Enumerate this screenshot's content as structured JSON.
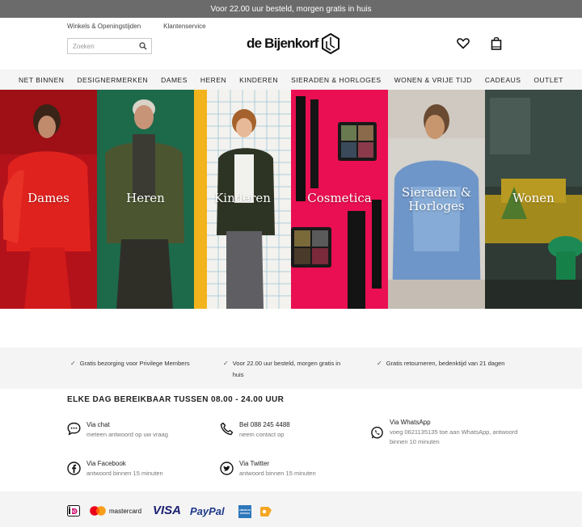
{
  "topbar": {
    "text": "Voor 22.00 uur besteld, morgen gratis in huis"
  },
  "header": {
    "links": [
      "Winkels & Openingstijden",
      "Klantenservice"
    ],
    "search_placeholder": "Zoeken",
    "logo_text": "de Bijenkorf"
  },
  "nav": [
    "NET BINNEN",
    "DESIGNERMERKEN",
    "DAMES",
    "HEREN",
    "KINDEREN",
    "SIERADEN & HORLOGES",
    "WONEN & VRIJE TIJD",
    "CADEAUS",
    "OUTLET"
  ],
  "tiles": [
    {
      "label": "Dames",
      "color": "#c8161d"
    },
    {
      "label": "Heren",
      "color": "#1e6b4c"
    },
    {
      "label": "Kinderen",
      "color": "#f0efe9"
    },
    {
      "label": "Cosmetica",
      "color": "#e8104f"
    },
    {
      "label": "Sieraden &",
      "label2": "Horloges",
      "color": "#7ea3cf"
    },
    {
      "label": "Wonen",
      "color": "#3e4a3a"
    }
  ],
  "usps": [
    "Gratis bezorging voor Privilege Members",
    "Voor 22.00 uur besteld, morgen gratis in",
    "huis",
    "Gratis retourneren, bedenktijd van 21 dagen"
  ],
  "contact": {
    "title": "ELKE DAG BEREIKBAAR TUSSEN 08.00 - 24.00 UUR",
    "items": [
      {
        "title": "Via chat",
        "desc": "meteen antwoord op uw vraag",
        "icon": "chat-icon"
      },
      {
        "title": "Bel 088 245 4488",
        "desc": "neem contact op",
        "icon": "phone-icon"
      },
      {
        "title": "Via WhatsApp",
        "desc": "voeg 0621135135 toe aan WhatsApp, antwoord",
        "desc2": "binnen 10 minuten",
        "icon": "whatsapp-icon"
      },
      {
        "title": "Via Facebook",
        "desc": "antwoord binnen 15 minuten",
        "icon": "facebook-icon"
      },
      {
        "title": "Via Twitter",
        "desc": "antwoord binnen 15 minuten",
        "icon": "twitter-icon"
      }
    ]
  },
  "payments": {
    "ideal": "iD",
    "mastercard": "mastercard",
    "visa": "VISA",
    "paypal": "PayPal",
    "amex": "AMERICAN EXPRESS"
  }
}
